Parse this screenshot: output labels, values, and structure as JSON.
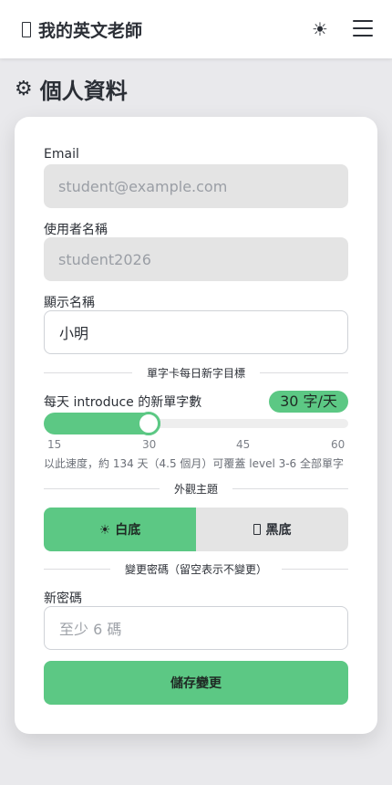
{
  "header": {
    "app_title": "我的英文老師",
    "theme_toggle_icon": "☀",
    "menu_icon": "hamburger-menu"
  },
  "page": {
    "icon": "⚙",
    "title": "個人資料"
  },
  "form": {
    "email": {
      "label": "Email",
      "value": "student@example.com"
    },
    "username": {
      "label": "使用者名稱",
      "value": "student2026"
    },
    "display_name": {
      "label": "顯示名稱",
      "value": "小明"
    },
    "goal_section": "單字卡每日新字目標",
    "goal": {
      "label": "每天 introduce 的新單字數",
      "value_text": "30 字/天",
      "value": 30,
      "min": 15,
      "max": 60,
      "ticks": [
        "15",
        "30",
        "45",
        "60"
      ],
      "hint": "以此速度，約 134 天（4.5 個月）可覆蓋 level 3-6 全部單字"
    },
    "theme_section": "外觀主題",
    "theme": {
      "light_label": "☀ 白底",
      "dark_label": "黑底",
      "selected": "light"
    },
    "password_section": "變更密碼（留空表示不變更）",
    "new_password": {
      "label": "新密碼",
      "placeholder": "至少 6 碼"
    },
    "save_label": "儲存變更"
  },
  "colors": {
    "accent": "#5cc884",
    "background": "#e9e9ec",
    "readonly_field": "#e4e4e4"
  }
}
